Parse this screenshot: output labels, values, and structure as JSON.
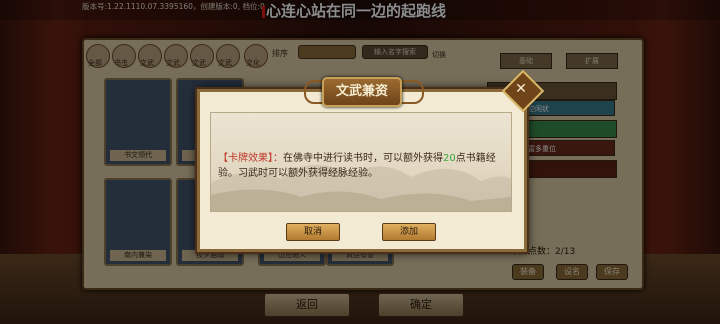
{
  "header": {
    "version": "版本号:1.22.1110.07.3395160，创建版本:0, 档位:0",
    "marquee": "心连心站在同一边的起跑线"
  },
  "filters": {
    "items": [
      "全部",
      "书虫",
      "文武",
      "文武",
      "文武",
      "文武",
      "文化"
    ],
    "sort_label": "排序",
    "sort_value": "",
    "search_placeholder": "输入名字搜索",
    "switch_label": "切换",
    "right_tabs": [
      "基础",
      "扩展"
    ]
  },
  "cards": [
    {
      "label": "书文领代"
    },
    {
      "label": ""
    },
    {
      "label": "南内兼染"
    },
    {
      "label": "夜夕酒涌"
    },
    {
      "label": "山左进人"
    },
    {
      "label": "真佳有墨"
    }
  ],
  "right_panel": {
    "slot_texts": [
      "",
      "空闲状",
      "",
      "富多重位"
    ],
    "page_label": "卡牌点数：2/13",
    "buttons": [
      "装备",
      "设名",
      "保存"
    ]
  },
  "bottom": {
    "back_label": "返回",
    "confirm_label": "确定"
  },
  "dialog": {
    "title": "文武兼资",
    "effect_key": "【卡牌效果】：",
    "effect_text_1": "在佛寺中进行读书时，可以额外获得",
    "effect_number": "20",
    "effect_text_2": "点书籍经验。习武时可以额外获得经脉经验。",
    "cancel_label": "取消",
    "add_label": "添加"
  },
  "colors": {
    "dialog_bg": "#f3ead4",
    "frame": "#8a6a3a",
    "effect_key": "#c0392b",
    "effect_number": "#3aa83a"
  }
}
